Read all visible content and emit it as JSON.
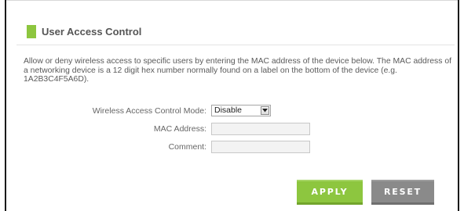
{
  "section": {
    "title": "User Access Control"
  },
  "description": "Allow or deny wireless access to specific users by entering the MAC address of the device below. The MAC address of a networking device is a 12 digit hex number normally found on a label on the bottom of the device (e.g. 1A2B3C4F5A6D).",
  "form": {
    "mode": {
      "label": "Wireless Access Control Mode:",
      "selected": "Disable"
    },
    "mac_address": {
      "label": "MAC Address:",
      "value": ""
    },
    "comment": {
      "label": "Comment:",
      "value": ""
    }
  },
  "buttons": {
    "apply": "APPLY",
    "reset": "RESET"
  },
  "colors": {
    "accent_green": "#8dc63f",
    "reset_gray": "#8a8a8a",
    "text": "#555555"
  },
  "icons": {
    "section_marker": "green-square-icon",
    "dropdown": "dropdown-arrow-icon"
  }
}
